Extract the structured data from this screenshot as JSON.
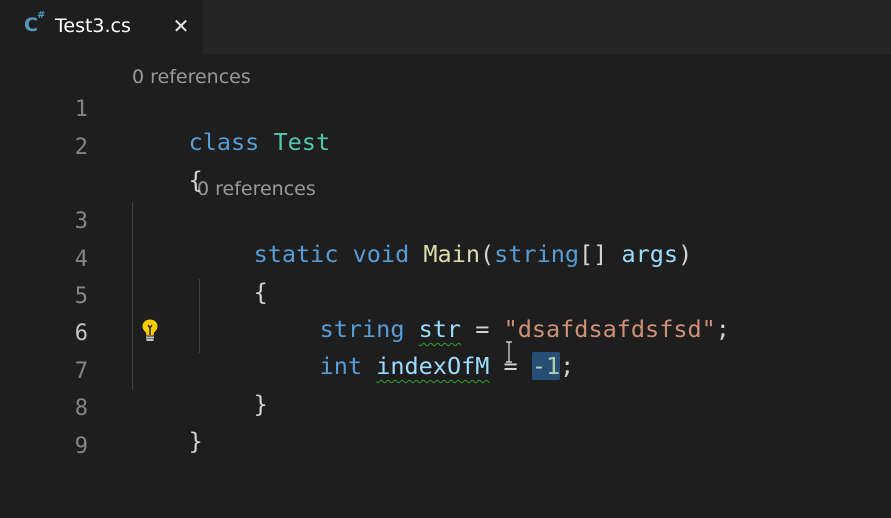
{
  "tab": {
    "title": "Test3.cs",
    "icon": "csharp-file-icon",
    "icon_letter": "C",
    "icon_sharp": "#",
    "close_glyph": "✕"
  },
  "editor": {
    "codelens": [
      "0 references",
      "0 references"
    ],
    "line_numbers": [
      "1",
      "2",
      "3",
      "4",
      "5",
      "6",
      "7",
      "8",
      "9"
    ],
    "active_line": "6",
    "lines": {
      "l1": {
        "kw": "class",
        "type": "Test"
      },
      "l2": {
        "brace": "{"
      },
      "l3": {
        "kw1": "static",
        "kw2": "void",
        "fn": "Main",
        "paren_open": "(",
        "kw3": "string",
        "brackets": "[]",
        "param": "args",
        "paren_close": ")"
      },
      "l4": {
        "brace": "{"
      },
      "l5": {
        "kw": "string",
        "var": "str",
        "op": "=",
        "str": "\"dsafdsafdsfsd\"",
        "semi": ";"
      },
      "l6": {
        "kw": "int",
        "var": "indexOfM",
        "op": "=",
        "num": "-1",
        "semi": ";"
      },
      "l7": {
        "brace": "}"
      },
      "l8": {
        "brace": "}"
      }
    },
    "theme": {
      "background": "#1e1e1e",
      "keyword": "#569cd6",
      "type": "#4ec9b0",
      "function": "#dcdcaa",
      "variable": "#9cdcfe",
      "string": "#ce9178",
      "number": "#b5cea8",
      "selection": "#264f78",
      "squiggle": "#2f9e2f",
      "bulb": "#ffcc00"
    }
  }
}
